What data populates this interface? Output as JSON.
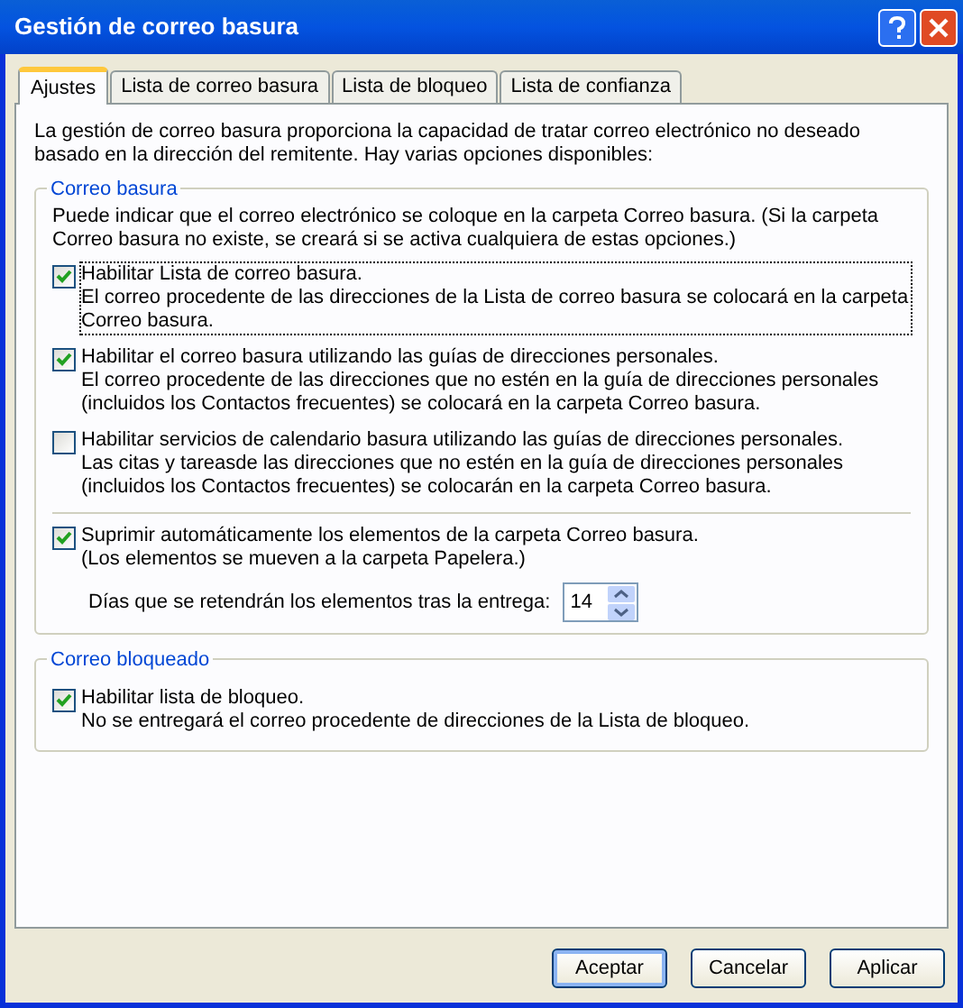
{
  "window": {
    "title": "Gestión de correo basura"
  },
  "tabs": [
    {
      "label": "Ajustes",
      "selected": true
    },
    {
      "label": "Lista de correo basura",
      "selected": false
    },
    {
      "label": "Lista de bloqueo",
      "selected": false
    },
    {
      "label": "Lista de confianza",
      "selected": false
    }
  ],
  "intro": "La gestión de correo basura proporciona la capacidad de tratar correo electrónico no deseado basado en la dirección del remitente. Hay varias opciones disponibles:",
  "junk_group": {
    "title": "Correo basura",
    "note": "Puede indicar que el correo electrónico se coloque en la carpeta Correo basura. (Si la carpeta Correo basura no existe, se creará si se activa cualquiera de estas opciones.)",
    "options": [
      {
        "label": "Habilitar Lista de correo basura.",
        "description": "El correo procedente de las direcciones de la Lista de correo basura se colocará en la carpeta Correo basura.",
        "checked": true,
        "focused": true
      },
      {
        "label": "Habilitar el correo basura utilizando las guías de direcciones personales.",
        "description": "El correo procedente de las direcciones que no estén en la guía de direcciones personales (incluidos los Contactos frecuentes) se colocará en la carpeta Correo basura.",
        "checked": true
      },
      {
        "label": "Habilitar servicios de calendario basura utilizando las guías de direcciones personales.",
        "description": "Las citas y tareasde las direcciones que no estén en la guía de direcciones personales (incluidos los Contactos frecuentes) se colocarán en la carpeta Correo basura.",
        "checked": false
      }
    ],
    "auto_delete": {
      "label": "Suprimir automáticamente los elementos de la carpeta Correo basura.",
      "description": "(Los elementos se mueven a la carpeta Papelera.)",
      "checked": true
    },
    "retention": {
      "label": "Días que se retendrán los elementos tras la entrega:",
      "value": "14"
    }
  },
  "blocked_group": {
    "title": "Correo bloqueado",
    "options": [
      {
        "label": "Habilitar lista de bloqueo.",
        "description": "No se entregará el correo procedente de direcciones de la Lista de bloqueo.",
        "checked": true
      }
    ]
  },
  "buttons": [
    {
      "label": "Aceptar",
      "default": true
    },
    {
      "label": "Cancelar",
      "default": false
    },
    {
      "label": "Aplicar",
      "default": false
    }
  ]
}
